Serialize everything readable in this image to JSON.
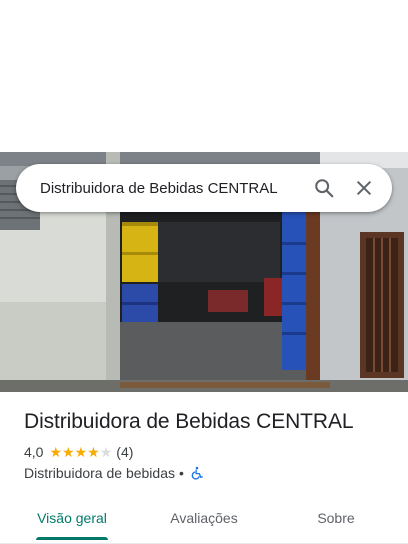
{
  "search": {
    "query": "Distribuidora de Bebidas CENTRAL"
  },
  "place": {
    "name": "Distribuidora de Bebidas CENTRAL",
    "rating": "4,0",
    "rating_value": 4,
    "rating_max": 5,
    "review_count": "(4)",
    "category": "Distribuidora de bebidas",
    "separator": "•"
  },
  "tabs": [
    {
      "label": "Visão geral",
      "active": true
    },
    {
      "label": "Avaliações",
      "active": false
    },
    {
      "label": "Sobre",
      "active": false
    }
  ],
  "colors": {
    "accent": "#00796b",
    "star": "#f9ab00",
    "wheelchair": "#1a73e8"
  },
  "icons": {
    "search": "search-icon",
    "close": "close-icon",
    "wheelchair": "wheelchair-accessible-icon"
  }
}
